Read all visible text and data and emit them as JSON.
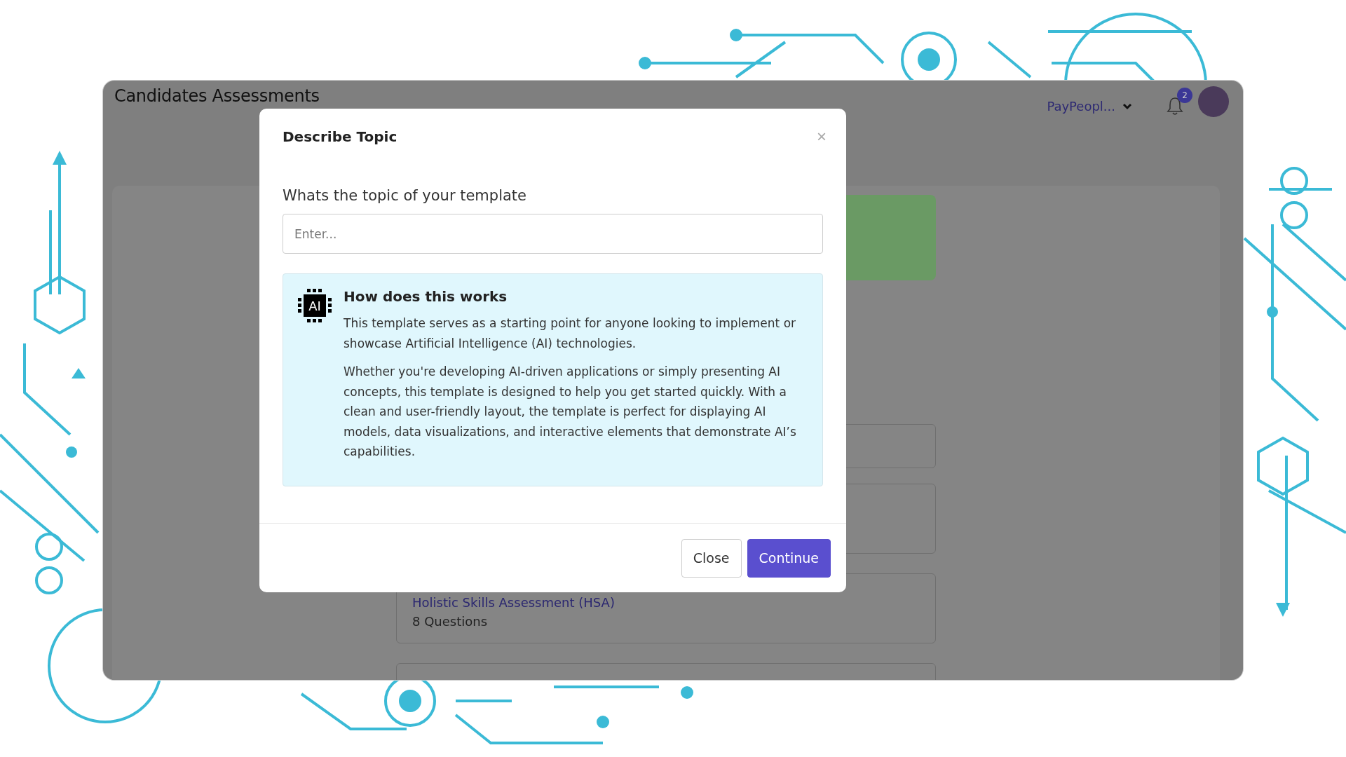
{
  "app": {
    "title": "Candidates Assessments",
    "company": "PayPeopl...",
    "notification_count": "2"
  },
  "background_cards": [
    {
      "title": "Holistic Skills Assessment (HSA)",
      "subtitle": "8 Questions"
    }
  ],
  "modal": {
    "title": "Describe Topic",
    "close_symbol": "×",
    "icon_text": "AI",
    "question": "Whats the topic of your template",
    "input": {
      "placeholder": "Enter..."
    },
    "info": {
      "title": "How does this works",
      "paragraphs": [
        "This template serves as a starting point for anyone looking to implement or showcase Artificial Intelligence (AI) technologies.",
        "Whether you're developing AI-driven applications or simply presenting AI concepts, this template is designed to help you get started quickly. With a clean and user-friendly layout, the template is perfect for displaying AI models, data visualizations, and interactive elements that demonstrate AI’s capabilities."
      ]
    },
    "buttons": [
      {
        "label": "Close",
        "kind": "secondary"
      },
      {
        "label": "Continue",
        "kind": "primary"
      }
    ]
  }
}
